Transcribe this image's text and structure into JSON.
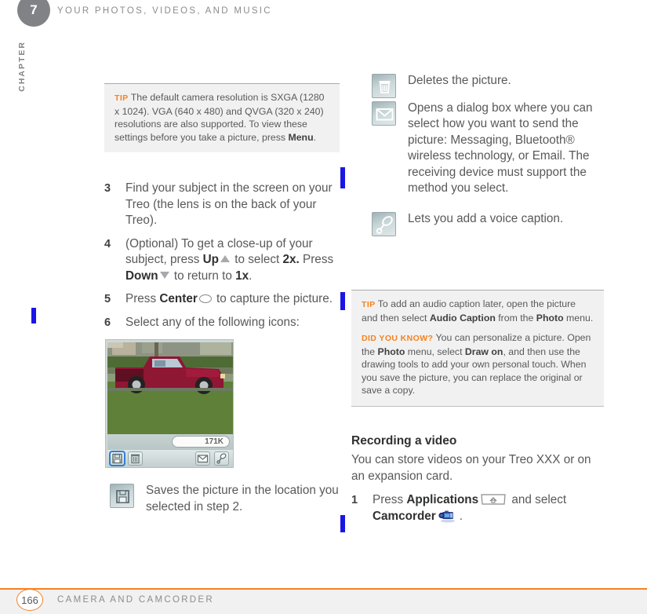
{
  "chapter": {
    "number": "7",
    "word": "CHAPTER"
  },
  "header": {
    "running_title": "YOUR PHOTOS, VIDEOS, AND MUSIC"
  },
  "footer": {
    "page_number": "166",
    "section_title": "CAMERA AND CAMCORDER"
  },
  "colors": {
    "accent_orange": "#f58220",
    "body_gray": "#58595b",
    "tip_background": "#f1f1f1",
    "change_bar_blue": "#1a16e6",
    "chapter_circle_gray": "#808285"
  },
  "tips": {
    "left": {
      "lead": "TIP",
      "text_1": " The default camera resolution is SXGA (1280 x 1024). VGA (640 x 480) and QVGA (320 x 240) resolutions are also supported. To view these settings before you take a picture, press ",
      "bold_1": "Menu",
      "text_2": "."
    },
    "right": {
      "lead_1": "TIP",
      "p1_a": " To add an audio caption later, open the picture and then select ",
      "p1_b": "Audio Caption",
      "p1_c": " from the ",
      "p1_d": "Photo",
      "p1_e": " menu.",
      "lead_2": "DID YOU KNOW?",
      "p2_a": " You can personalize a picture. Open the ",
      "p2_b": "Photo",
      "p2_c": " menu, select ",
      "p2_d": "Draw on",
      "p2_e": ", and then use the drawing tools to add your own personal touch. When you save the picture, you can replace the original or save a copy."
    }
  },
  "steps": [
    {
      "num": "3",
      "parts": [
        {
          "type": "text",
          "value": "Find your subject in the screen on your Treo (the lens is on the back of your Treo)."
        }
      ]
    },
    {
      "num": "4",
      "parts": [
        {
          "type": "text",
          "value": "(Optional)  To get a close-up of your subject, press "
        },
        {
          "type": "bold",
          "value": "Up"
        },
        {
          "type": "icon",
          "value": "triangle-up-icon"
        },
        {
          "type": "text",
          "value": " to select "
        },
        {
          "type": "bold",
          "value": "2x."
        },
        {
          "type": "text",
          "value": " Press "
        },
        {
          "type": "bold",
          "value": "Down"
        },
        {
          "type": "icon",
          "value": "triangle-down-icon"
        },
        {
          "type": "text",
          "value": " to return to "
        },
        {
          "type": "bold",
          "value": "1x"
        },
        {
          "type": "text",
          "value": "."
        }
      ]
    },
    {
      "num": "5",
      "parts": [
        {
          "type": "text",
          "value": "Press "
        },
        {
          "type": "bold",
          "value": "Center"
        },
        {
          "type": "icon",
          "value": "center-key-icon"
        },
        {
          "type": "text",
          "value": " to capture the picture."
        }
      ]
    },
    {
      "num": "6",
      "parts": [
        {
          "type": "text",
          "value": "Select any of the following icons:"
        }
      ]
    }
  ],
  "step_text": {
    "s3": "Find your subject in the screen on your Treo (the lens is on the back of your Treo).",
    "s4_a": "(Optional)  To get a close-up of your subject, press ",
    "s4_up": "Up",
    "s4_b": " to select ",
    "s4_2x": "2x.",
    "s4_c": " Press ",
    "s4_down": "Down",
    "s4_d": " to return to ",
    "s4_1x": "1x",
    "s4_e": ".",
    "s5_a": "Press ",
    "s5_center": "Center",
    "s5_b": " to capture the picture.",
    "s6": "Select any of the following icons:",
    "num_3": "3",
    "num_4": "4",
    "num_5": "5",
    "num_6": "6"
  },
  "phone_screenshot": {
    "alt": "Treo camera preview showing a red pickup truck parked on grass",
    "file_size_label": "171K",
    "toolbar_icons": [
      {
        "name": "save-icon",
        "selected": true
      },
      {
        "name": "trash-icon",
        "selected": false
      },
      {
        "name": "envelope-icon",
        "selected": false
      },
      {
        "name": "microphone-icon",
        "selected": false
      }
    ]
  },
  "icon_captions": {
    "save": {
      "icon": "save-floppy-icon",
      "text": "Saves the picture in the location you selected in step 2."
    },
    "delete": {
      "icon": "trash-icon",
      "text": "Deletes the picture."
    },
    "send": {
      "icon": "envelope-icon",
      "text": "Opens a dialog box where you can select how you want to send the picture: Messaging, Bluetooth® wireless technology, or Email. The receiving device must support the method you select."
    },
    "voice": {
      "icon": "microphone-icon",
      "text": "Lets you add a voice caption."
    }
  },
  "recording_section": {
    "heading": "Recording a video",
    "intro": "You can store videos on your Treo XXX or on an expansion card.",
    "step": {
      "num": "1",
      "a": "Press ",
      "bold_applications": "Applications",
      "icon_key": "applications-key-icon",
      "b": " and select ",
      "bold_camcorder": "Camcorder",
      "icon_camcorder": "camcorder-icon",
      "c": "."
    }
  }
}
